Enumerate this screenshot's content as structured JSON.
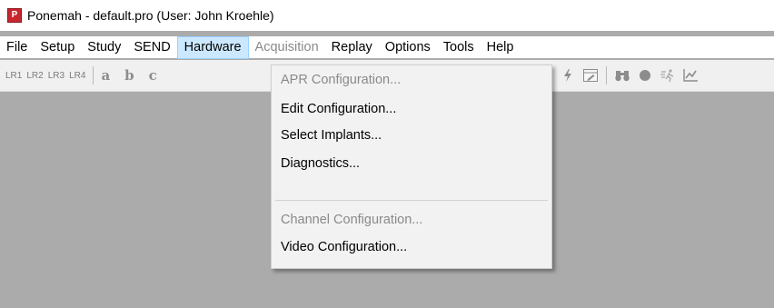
{
  "window": {
    "title": "Ponemah - default.pro (User: John Kroehle)",
    "app_icon_letter": "P"
  },
  "menubar": {
    "items": [
      {
        "label": "File",
        "state": "normal"
      },
      {
        "label": "Setup",
        "state": "normal"
      },
      {
        "label": "Study",
        "state": "normal"
      },
      {
        "label": "SEND",
        "state": "normal"
      },
      {
        "label": "Hardware",
        "state": "active"
      },
      {
        "label": "Acquisition",
        "state": "disabled"
      },
      {
        "label": "Replay",
        "state": "normal"
      },
      {
        "label": "Options",
        "state": "normal"
      },
      {
        "label": "Tools",
        "state": "normal"
      },
      {
        "label": "Help",
        "state": "normal"
      }
    ]
  },
  "toolbar": {
    "lr_buttons": [
      "LR1",
      "LR2",
      "LR3",
      "LR4"
    ],
    "letter_buttons": [
      "a",
      "b",
      "c"
    ],
    "right_icons": [
      "lightning-icon",
      "edit-window-icon",
      "binoculars-icon",
      "record-icon",
      "run-icon",
      "chart-icon"
    ]
  },
  "hardware_menu": {
    "items": [
      {
        "label": "APR Configuration...",
        "enabled": false
      },
      {
        "label": "Edit Configuration...",
        "enabled": true
      },
      {
        "label": "Select Implants...",
        "enabled": true
      },
      {
        "label": "Diagnostics...",
        "enabled": true
      },
      {
        "label": "Channel Configuration...",
        "enabled": false
      },
      {
        "label": "Video Configuration...",
        "enabled": true
      }
    ]
  },
  "colors": {
    "workspace_bg": "#ababab",
    "menu_active_bg": "#cce8ff",
    "menu_active_border": "#99d1ff",
    "disabled_text": "#8a8a8a",
    "app_icon_red": "#c8262e"
  }
}
